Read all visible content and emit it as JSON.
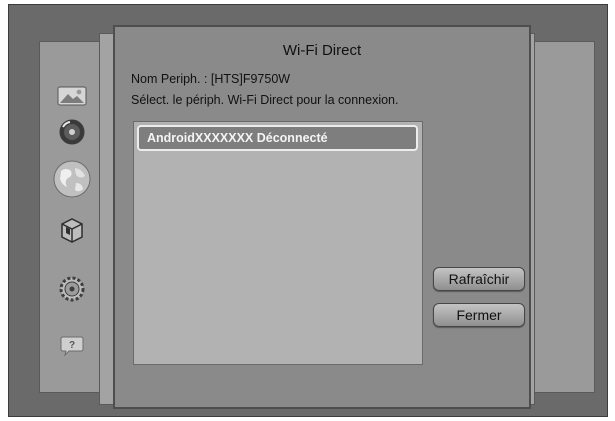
{
  "dialog": {
    "title": "Wi-Fi Direct",
    "device_name": "Nom Periph. : [HTS]F9750W",
    "instruction": "Sélect. le périph. Wi-Fi Direct pour la connexion."
  },
  "devices": [
    {
      "label": "AndroidXXXXXXX Déconnecté"
    }
  ],
  "buttons": {
    "refresh": "Rafraîchir",
    "close": "Fermer"
  },
  "sidebar": {
    "icons": [
      "picture-icon",
      "music-disc-icon",
      "globe-icon",
      "box-icon",
      "gear-icon",
      "help-icon"
    ]
  }
}
